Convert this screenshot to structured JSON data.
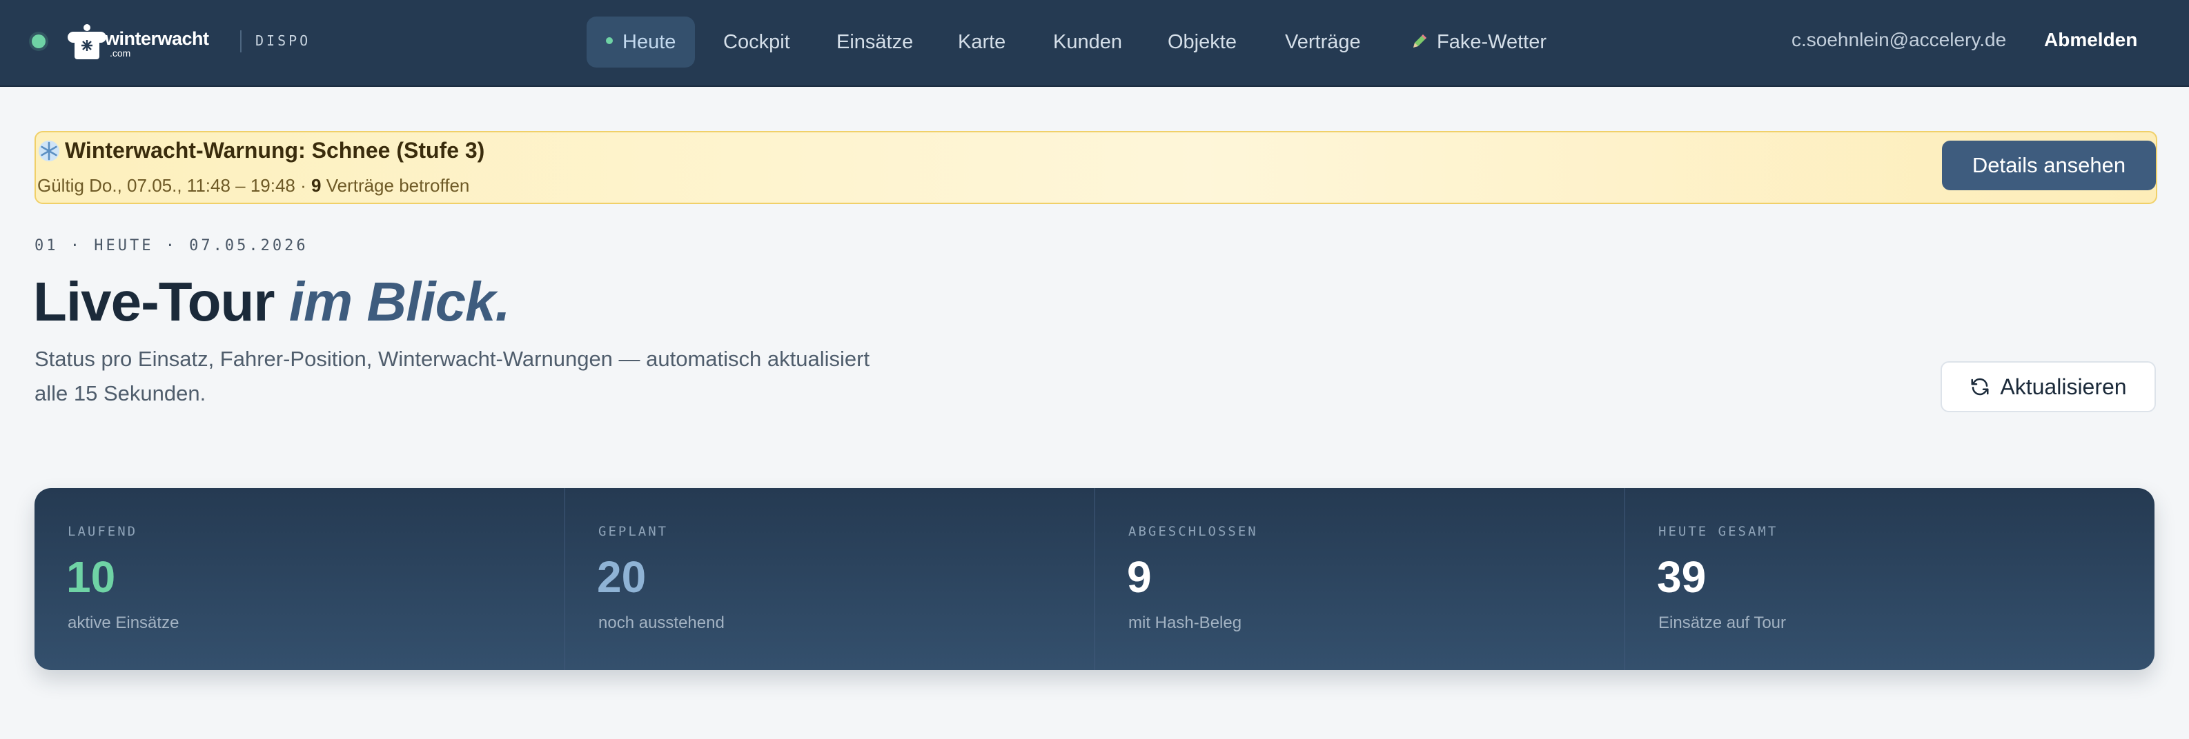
{
  "brand": {
    "name": "winterwacht",
    "sub": ".com",
    "tag": "DISPO"
  },
  "nav": {
    "items": [
      {
        "label": "Heute",
        "active": true
      },
      {
        "label": "Cockpit"
      },
      {
        "label": "Einsätze"
      },
      {
        "label": "Karte"
      },
      {
        "label": "Kunden"
      },
      {
        "label": "Objekte"
      },
      {
        "label": "Verträge"
      },
      {
        "label": "Fake-Wetter",
        "icon": "pencil-icon"
      }
    ],
    "user_email": "c.soehnlein@accelery.de",
    "logout": "Abmelden"
  },
  "warning": {
    "icon": "snowflake-icon",
    "title": "Winterwacht-Warnung: Schnee (Stufe 3)",
    "valid_prefix": "Gültig Do., 07.05., 11:48 – 19:48 · ",
    "count": "9",
    "valid_suffix": " Verträge betroffen",
    "button": "Details ansehen"
  },
  "header": {
    "eyebrow": "01 · HEUTE · 07.05.2026",
    "title_main": "Live-Tour ",
    "title_accent": "im Blick.",
    "lead": "Status pro Einsatz, Fahrer-Position, Winterwacht-Warnungen — automatisch aktualisiert alle 15 Sekunden.",
    "refresh": "Aktualisieren"
  },
  "stats": [
    {
      "label": "LAUFEND",
      "value": "10",
      "caption": "aktive Einsätze",
      "color": "#6fd3a5"
    },
    {
      "label": "GEPLANT",
      "value": "20",
      "caption": "noch ausstehend",
      "color": "#8fb3d5"
    },
    {
      "label": "ABGESCHLOSSEN",
      "value": "9",
      "caption": "mit Hash-Beleg",
      "color": "#ffffff"
    },
    {
      "label": "HEUTE GESAMT",
      "value": "39",
      "caption": "Einsätze auf Tour",
      "color": "#ffffff"
    }
  ],
  "colors": {
    "nav_bg": "#253a52",
    "accent": "#3e5c7e",
    "status_green": "#6fd3a5",
    "warning_bg": "#fdf0bd"
  }
}
